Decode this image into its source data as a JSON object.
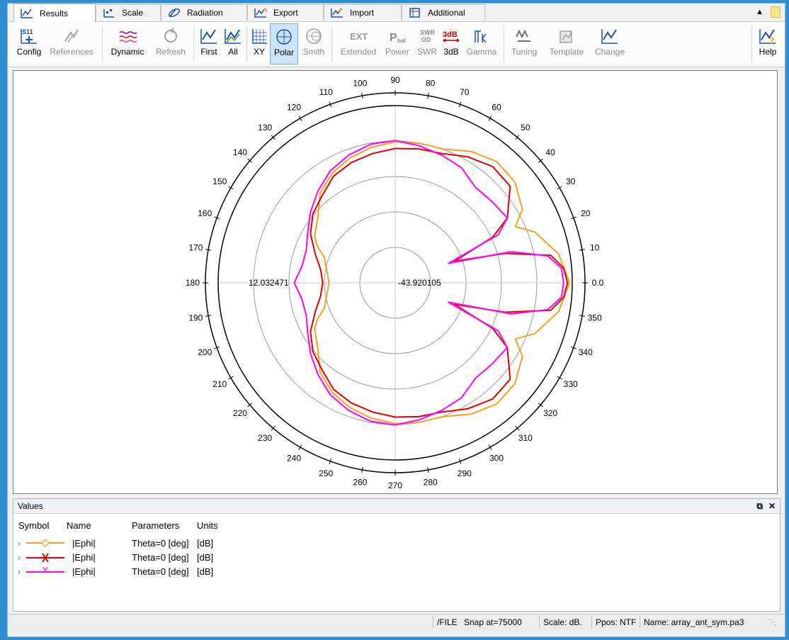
{
  "tabs": [
    {
      "label": "Results",
      "icon": "results-icon",
      "active": true
    },
    {
      "label": "Scale",
      "icon": "scale-icon"
    },
    {
      "label": "Radiation",
      "icon": "radiation-icon"
    },
    {
      "label": "Export",
      "icon": "export-icon"
    },
    {
      "label": "Import",
      "icon": "import-icon"
    },
    {
      "label": "Additional",
      "icon": "additional-icon"
    }
  ],
  "toolbar": {
    "config": "Config",
    "references": "References",
    "dynamic": "Dynamic",
    "refresh": "Refresh",
    "first": "First",
    "all": "All",
    "xy": "XY",
    "polar": "Polar",
    "smith": "Smith",
    "extended": "Extended",
    "power": "Power",
    "swr": "SWR",
    "db3": "3dB",
    "gamma": "Gamma",
    "tuning": "Tuning",
    "template": "Template",
    "change": "Change",
    "help": "Help",
    "icon_text": {
      "s11": "S11",
      "ext": "EXT",
      "pbal": "P",
      "pbal_sub": "bal",
      "swr_gd_top": "SWR",
      "swr_gd_bottom": "GD",
      "db3": "3dB"
    }
  },
  "chart_data": {
    "type": "polar",
    "angular_ticks": [
      0,
      10,
      20,
      30,
      40,
      50,
      60,
      70,
      80,
      90,
      100,
      110,
      120,
      130,
      140,
      150,
      160,
      170,
      180,
      190,
      200,
      210,
      220,
      230,
      240,
      250,
      260,
      270,
      280,
      290,
      300,
      310,
      320,
      330,
      340,
      350
    ],
    "zero_label": "0.0",
    "radial_min_label": "-43.920105",
    "radial_max_label": "12.032471",
    "radial_range": [
      -43.920105,
      12.032471
    ],
    "grid": true,
    "series": [
      {
        "name": "|Ephi|",
        "color": "#f5a11c",
        "points": [
          [
            0,
            11.2
          ],
          [
            10,
            8.5
          ],
          [
            20,
            3
          ],
          [
            25,
            -2
          ],
          [
            30,
            2.5
          ],
          [
            40,
            5.5
          ],
          [
            50,
            6
          ],
          [
            60,
            4
          ],
          [
            70,
            1
          ],
          [
            80,
            0.8
          ],
          [
            90,
            0.6
          ],
          [
            100,
            -0.5
          ],
          [
            110,
            -2
          ],
          [
            120,
            -4
          ],
          [
            130,
            -7
          ],
          [
            140,
            -12
          ],
          [
            150,
            -14.5
          ],
          [
            155,
            -16.8
          ],
          [
            160,
            -20
          ],
          [
            170,
            -22
          ],
          [
            180,
            -23
          ],
          [
            190,
            -22
          ],
          [
            200,
            -20
          ],
          [
            205,
            -16.8
          ],
          [
            210,
            -14.5
          ],
          [
            220,
            -12
          ],
          [
            230,
            -7
          ],
          [
            240,
            -4
          ],
          [
            250,
            -2
          ],
          [
            260,
            -0.5
          ],
          [
            270,
            0.6
          ],
          [
            280,
            0.8
          ],
          [
            290,
            1
          ],
          [
            300,
            4
          ],
          [
            310,
            6
          ],
          [
            320,
            5.5
          ],
          [
            330,
            2.5
          ],
          [
            335,
            -2
          ],
          [
            340,
            3
          ],
          [
            350,
            8.5
          ],
          [
            360,
            11.2
          ]
        ]
      },
      {
        "name": "|Ephi|",
        "color": "#e00000",
        "points": [
          [
            0,
            10.5
          ],
          [
            5,
            9.5
          ],
          [
            10,
            6
          ],
          [
            15,
            -8
          ],
          [
            20,
            -24
          ],
          [
            25,
            -10
          ],
          [
            30,
            -3
          ],
          [
            40,
            3.5
          ],
          [
            50,
            4
          ],
          [
            60,
            2
          ],
          [
            70,
            -0.5
          ],
          [
            80,
            -1
          ],
          [
            90,
            -1.5
          ],
          [
            100,
            -2.5
          ],
          [
            110,
            -3.5
          ],
          [
            120,
            -5
          ],
          [
            130,
            -8
          ],
          [
            140,
            -10
          ],
          [
            150,
            -13
          ],
          [
            160,
            -17
          ],
          [
            170,
            -20
          ],
          [
            180,
            -21
          ],
          [
            190,
            -20
          ],
          [
            200,
            -17
          ],
          [
            210,
            -13
          ],
          [
            220,
            -10
          ],
          [
            230,
            -8
          ],
          [
            240,
            -5
          ],
          [
            250,
            -3.5
          ],
          [
            260,
            -2.5
          ],
          [
            270,
            -1.5
          ],
          [
            280,
            -1
          ],
          [
            290,
            -0.5
          ],
          [
            300,
            2
          ],
          [
            310,
            4
          ],
          [
            320,
            3.5
          ],
          [
            330,
            -3
          ],
          [
            335,
            -10
          ],
          [
            340,
            -24
          ],
          [
            345,
            -8
          ],
          [
            350,
            6
          ],
          [
            355,
            9.5
          ],
          [
            360,
            10.5
          ]
        ]
      },
      {
        "name": "|Ephi|",
        "color": "#ff00ff",
        "points": [
          [
            0,
            9.3
          ],
          [
            5,
            8.8
          ],
          [
            10,
            5
          ],
          [
            15,
            -6
          ],
          [
            20,
            -26
          ],
          [
            25,
            -8
          ],
          [
            30,
            -3
          ],
          [
            40,
            -4
          ],
          [
            50,
            -4.5
          ],
          [
            60,
            -2
          ],
          [
            70,
            -1
          ],
          [
            80,
            0
          ],
          [
            90,
            1
          ],
          [
            100,
            0.5
          ],
          [
            110,
            -1
          ],
          [
            120,
            -3
          ],
          [
            130,
            -6
          ],
          [
            140,
            -9
          ],
          [
            150,
            -12
          ],
          [
            160,
            -14
          ],
          [
            170,
            -14
          ],
          [
            180,
            -12
          ],
          [
            190,
            -14
          ],
          [
            200,
            -14
          ],
          [
            210,
            -12
          ],
          [
            220,
            -9
          ],
          [
            230,
            -6
          ],
          [
            240,
            -3
          ],
          [
            250,
            -1
          ],
          [
            260,
            0.5
          ],
          [
            270,
            1
          ],
          [
            280,
            0
          ],
          [
            290,
            -1
          ],
          [
            300,
            -2
          ],
          [
            310,
            -4.5
          ],
          [
            320,
            -4
          ],
          [
            330,
            -3
          ],
          [
            335,
            -8
          ],
          [
            340,
            -26
          ],
          [
            345,
            -6
          ],
          [
            350,
            5
          ],
          [
            355,
            8.8
          ],
          [
            360,
            9.3
          ]
        ]
      }
    ]
  },
  "values_panel": {
    "title": "Values",
    "columns": {
      "symbol": "Symbol",
      "name": "Name",
      "parameters": "Parameters",
      "units": "Units"
    },
    "rows": [
      {
        "name": "|Ephi|",
        "parameters": "Theta=0 [deg]",
        "units": "[dB]",
        "color": "#f5a11c",
        "marker": "diamond"
      },
      {
        "name": "|Ephi|",
        "parameters": "Theta=0 [deg]",
        "units": "[dB]",
        "color": "#e00000",
        "marker": "x"
      },
      {
        "name": "|Ephi|",
        "parameters": "Theta=0 [deg]",
        "units": "[dB]",
        "color": "#ff00ff",
        "marker": "v"
      }
    ]
  },
  "status": {
    "file": "/FILE",
    "snap": "Snap at=75000",
    "scale": "Scale: dB.",
    "ppos": "Ppos: NTF",
    "name": "Name:  array_ant_sym.pa3"
  }
}
